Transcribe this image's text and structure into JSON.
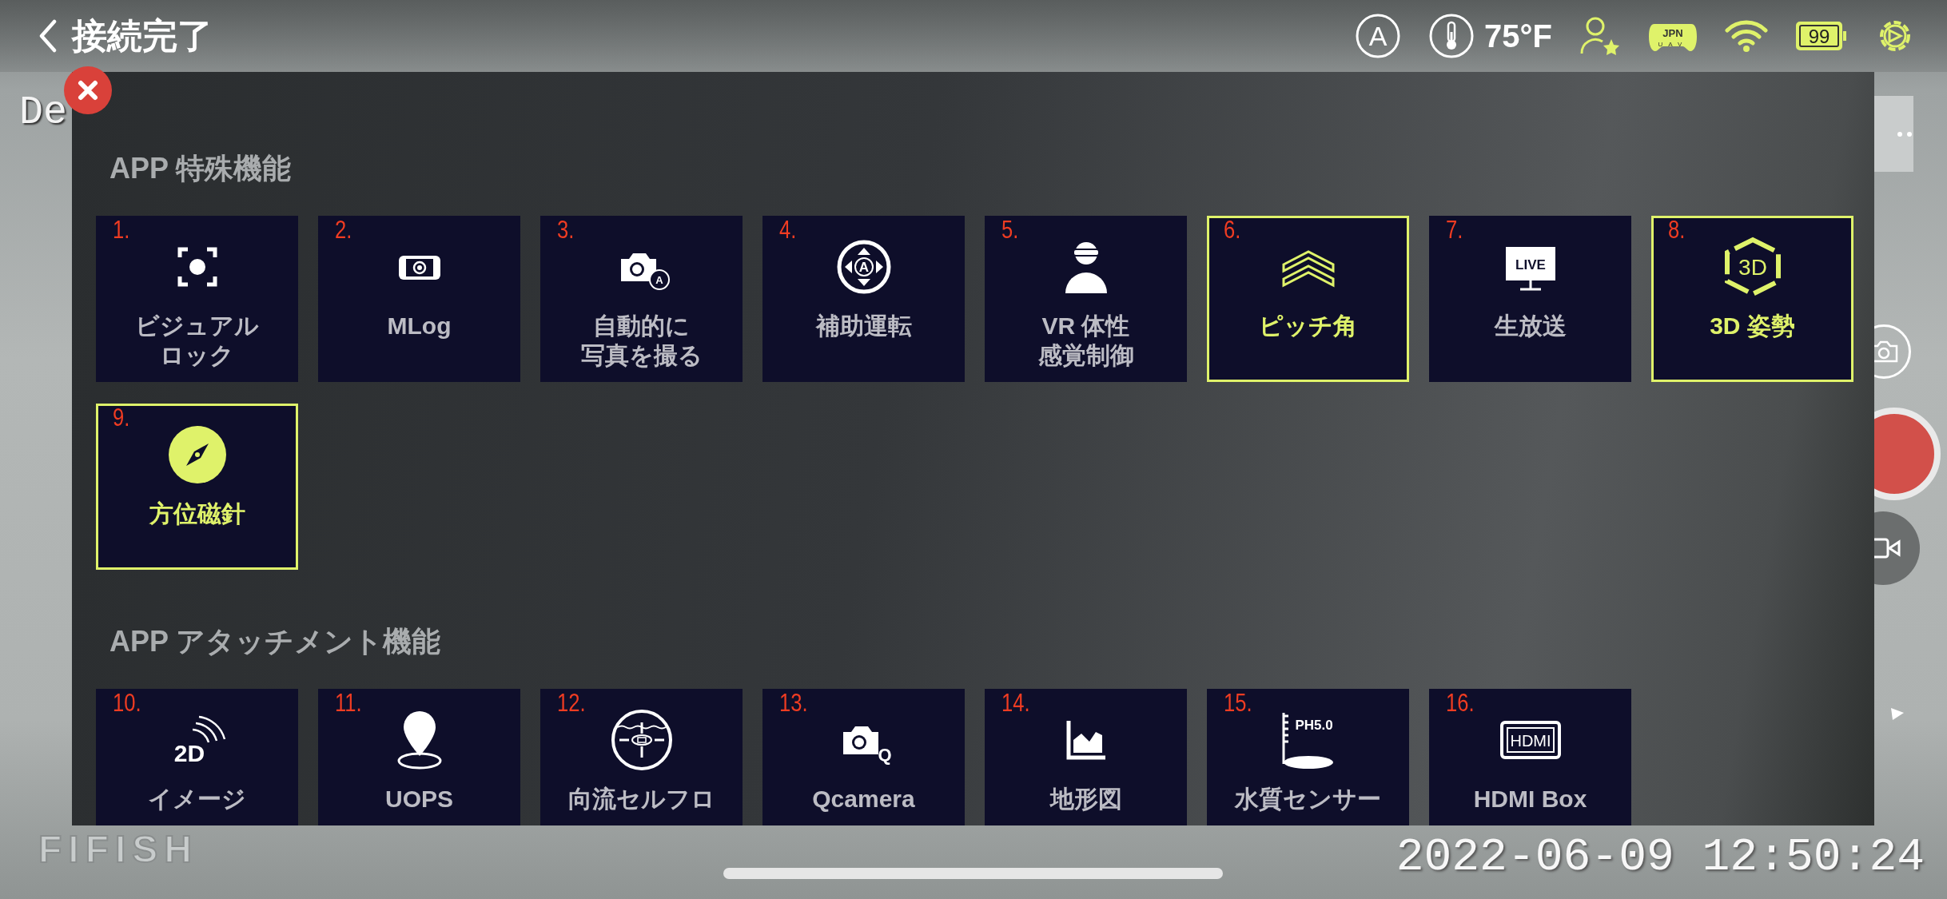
{
  "header": {
    "title": "接続完了"
  },
  "status": {
    "mode": "A",
    "temperature": "75°F",
    "controller_region": "JPN",
    "controller_sub": "UAV",
    "battery": "99"
  },
  "camera": {
    "overlay_text": "De",
    "logo": "FIFISH",
    "timestamp": "2022-06-09 12:50:24"
  },
  "sections": [
    {
      "title": "APP 特殊機能",
      "tiles": [
        {
          "number": "1.",
          "lines": [
            "ビジュアル",
            "ロック"
          ],
          "selected": false
        },
        {
          "number": "2.",
          "lines": [
            "MLog"
          ],
          "selected": false
        },
        {
          "number": "3.",
          "lines": [
            "自動的に",
            "写真を撮る"
          ],
          "icon_text": "A",
          "selected": false
        },
        {
          "number": "4.",
          "lines": [
            "補助運転"
          ],
          "icon_text": "A",
          "selected": false
        },
        {
          "number": "5.",
          "lines": [
            "VR 体性",
            "感覚制御"
          ],
          "selected": false
        },
        {
          "number": "6.",
          "lines": [
            "ピッチ角"
          ],
          "selected": true
        },
        {
          "number": "7.",
          "lines": [
            "生放送"
          ],
          "icon_text": "LIVE",
          "selected": false
        },
        {
          "number": "8.",
          "lines": [
            "3D 姿勢"
          ],
          "icon_text": "3D",
          "selected": true
        },
        {
          "number": "9.",
          "lines": [
            "方位磁針"
          ],
          "selected": true
        }
      ]
    },
    {
      "title": "APP アタッチメント機能",
      "tiles": [
        {
          "number": "10.",
          "lines": [
            "イメージ"
          ],
          "icon_text": "2D",
          "selected": false
        },
        {
          "number": "11.",
          "lines": [
            "UOPS"
          ],
          "selected": false
        },
        {
          "number": "12.",
          "lines": [
            "向流セルフロ"
          ],
          "selected": false
        },
        {
          "number": "13.",
          "lines": [
            "Qcamera"
          ],
          "icon_text": "Q",
          "selected": false
        },
        {
          "number": "14.",
          "lines": [
            "地形図"
          ],
          "selected": false
        },
        {
          "number": "15.",
          "lines": [
            "水質センサー"
          ],
          "icon_text": "PH5.0",
          "selected": false
        },
        {
          "number": "16.",
          "lines": [
            "HDMI Box"
          ],
          "icon_text": "HDMI",
          "selected": false
        }
      ]
    }
  ]
}
